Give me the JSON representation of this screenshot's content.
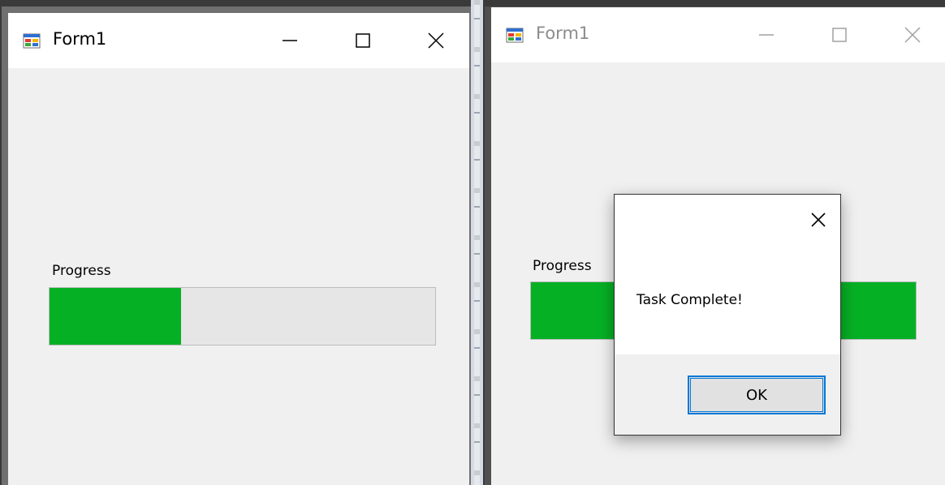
{
  "left_window": {
    "title": "Form1",
    "label": "Progress",
    "progress": 0.34
  },
  "right_window": {
    "title": "Form1",
    "label": "Progress",
    "progress": 1.0
  },
  "dialog": {
    "message": "Task Complete!",
    "ok_label": "OK"
  },
  "colors": {
    "progress_fill": "#06b025",
    "progress_track": "#e6e6e6",
    "focus_border": "#0078d7",
    "inactive_title": "#8c8c8c"
  },
  "icons": [
    "form-app-icon",
    "minimize-icon",
    "maximize-icon",
    "close-icon"
  ]
}
